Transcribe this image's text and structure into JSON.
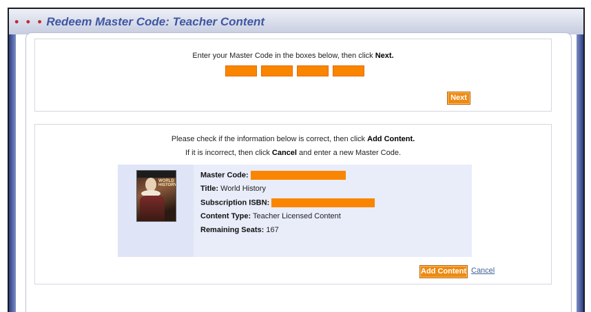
{
  "window": {
    "title": "Redeem Master Code: Teacher Content",
    "title_dots": "• • •"
  },
  "step1": {
    "instruction_prefix": "Enter your Master Code in the boxes below, then click",
    "instruction_bold": "Next.",
    "code_boxes": [
      "",
      "",
      "",
      ""
    ],
    "next_label": "Next"
  },
  "step2": {
    "line1_prefix": "Please check if the information below is correct, then click",
    "line1_bold": "Add Content.",
    "line2_prefix": "If it is incorrect, then click",
    "line2_bold": "Cancel",
    "line2_suffix": "and enter a new Master Code.",
    "master_code_label": "Master Code:",
    "title_label": "Title:",
    "title_value": "World History",
    "isbn_label": "Subscription ISBN:",
    "content_type_label": "Content Type:",
    "content_type_value": "Teacher Licensed Content",
    "seats_label": "Remaining Seats:",
    "seats_value": "167",
    "book_cover_text": "WORLD HISTORY",
    "add_content_label": "Add Content",
    "cancel_label": "Cancel"
  },
  "colors": {
    "accent": "#f98500",
    "title": "#3f56a3",
    "dots": "#c0262c"
  }
}
